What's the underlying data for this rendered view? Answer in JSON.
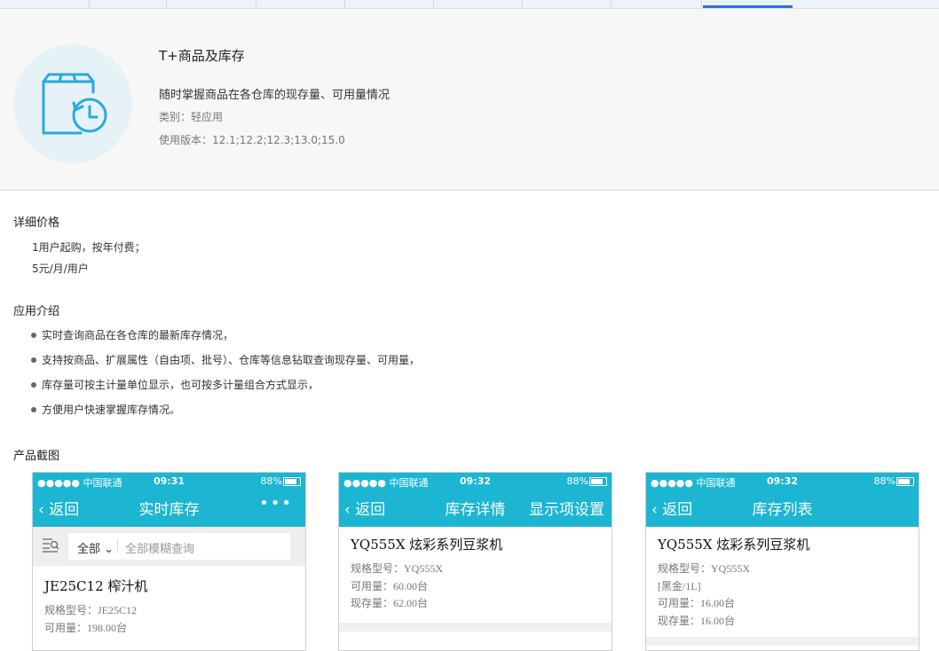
{
  "tabs": [
    "",
    "",
    "",
    "",
    "",
    "",
    "",
    ""
  ],
  "header": {
    "title": "T+商品及库存",
    "desc": "随时掌握商品在各仓库的现存量、可用量情况",
    "category": "类别：轻应用",
    "version": "使用版本：12.1;12.2;12.3;13.0;15.0"
  },
  "price": {
    "title": "详细价格",
    "lines": [
      "1用户起购，按年付费；",
      "5元/月/用户"
    ]
  },
  "intro": {
    "title": "应用介绍",
    "items": [
      "实时查询商品在各仓库的最新库存情况，",
      "支持按商品、扩展属性（自由项、批号）、仓库等信息钻取查询现存量、可用量，",
      "库存量可按主计量单位显示，也可按多计量组合方式显示，",
      "方便用户快速掌握库存情况。"
    ]
  },
  "screenshots": {
    "title": "产品截图",
    "phones": [
      {
        "carrier": "●●●●● 中国联通",
        "time": "09:31",
        "battery": "88%",
        "back": "返回",
        "nav_title": "实时库存",
        "search_all": "全部",
        "search_placeholder": "全部模糊查询",
        "item_name": "JE25C12 榨汁机",
        "lines": [
          "规格型号：JE25C12",
          "可用量：198.00台"
        ]
      },
      {
        "carrier": "●●●●● 中国联通",
        "time": "09:32",
        "battery": "88%",
        "back": "返回",
        "nav_title": "库存详情",
        "nav_right": "显示项设置",
        "item_name": "YQ555X 炫彩系列豆浆机",
        "lines": [
          "规格型号：YQ555X",
          "可用量：60.00台",
          "现存量：62.00台"
        ]
      },
      {
        "carrier": "●●●●● 中国联通",
        "time": "09:32",
        "battery": "88%",
        "back": "返回",
        "nav_title": "库存列表",
        "item_name": "YQ555X 炫彩系列豆浆机",
        "lines": [
          "规格型号：YQ555X",
          "[黑金/1L]",
          "可用量：16.00台",
          "现存量：16.00台"
        ]
      }
    ]
  },
  "colors": {
    "accent": "#1cb5d2",
    "tab_active": "#2a73d9",
    "logo_bg": "#e6f1f8"
  }
}
